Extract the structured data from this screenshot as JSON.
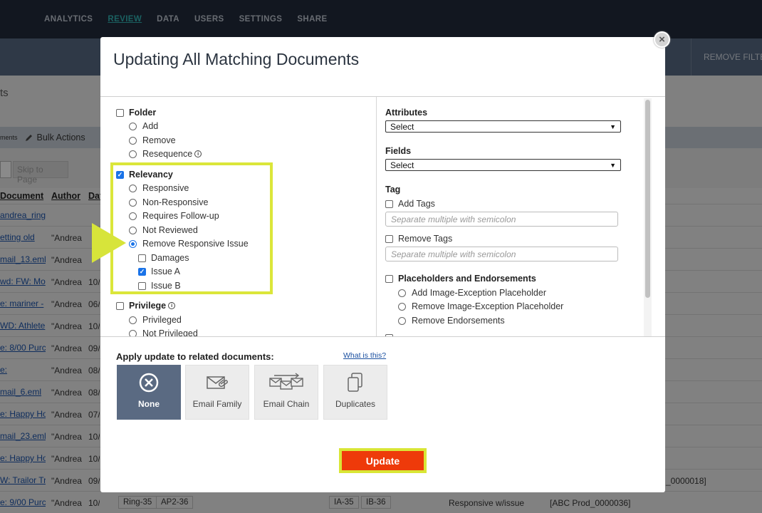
{
  "nav": {
    "items": [
      "ANALYTICS",
      "REVIEW",
      "DATA",
      "USERS",
      "SETTINGS",
      "SHARE"
    ],
    "active": "REVIEW"
  },
  "toolbar": {
    "remove_filters": "REMOVE FILTE"
  },
  "page": {
    "subtitle": "ts"
  },
  "actions": {
    "fragment": "ments",
    "bulk_actions": "Bulk Actions"
  },
  "pager": {
    "skip_placeholder": "Skip to Page"
  },
  "grid": {
    "headers": [
      "Document",
      "Author",
      "Dat"
    ],
    "rows": [
      {
        "doc": "andrea_ring_l",
        "author": "",
        "date": ""
      },
      {
        "doc": "etting old",
        "author": "\"Andrea",
        "date": ""
      },
      {
        "doc": "mail_13.eml",
        "author": "\"Andrea",
        "date": ""
      },
      {
        "doc": "wd: FW: Mo",
        "author": "\"Andrea",
        "date": "10/"
      },
      {
        "doc": "e: mariner -",
        "author": "\"Andrea",
        "date": "06/"
      },
      {
        "doc": "WD: Athlete",
        "author": "\"Andrea",
        "date": "10/"
      },
      {
        "doc": "e: 8/00 Purc",
        "author": "\"Andrea",
        "date": "09/"
      },
      {
        "doc": "e:",
        "author": "\"Andrea",
        "date": "08/"
      },
      {
        "doc": "mail_6.eml",
        "author": "\"Andrea",
        "date": "08/"
      },
      {
        "doc": "e: Happy Ho",
        "author": "\"Andrea",
        "date": "07/"
      },
      {
        "doc": "mail_23.eml",
        "author": "\"Andrea",
        "date": "10/"
      },
      {
        "doc": "e: Happy Ho",
        "author": "\"Andrea",
        "date": "10/"
      },
      {
        "doc": "W: Trailor Tr",
        "author": "\"Andrea",
        "date": "09/"
      },
      {
        "doc": "e: 9/00 Purc",
        "author": "\"Andrea",
        "date": "10/1("
      }
    ],
    "last_row_chips": [
      "Ring-35",
      "AP2-36",
      "IA-35",
      "IB-36"
    ],
    "last_row_relevancy": "Responsive w/issue",
    "last_row_bates": "[ABC Prod_0000036]",
    "prev_row_bates": "_0000018]"
  },
  "modal": {
    "title": "Updating All Matching Documents",
    "close_symbol": "×",
    "left": {
      "folder": {
        "label": "Folder",
        "options": [
          "Add",
          "Remove",
          "Resequence"
        ]
      },
      "relevancy": {
        "label": "Relevancy",
        "options": [
          "Responsive",
          "Non-Responsive",
          "Requires Follow-up",
          "Not Reviewed",
          "Remove Responsive Issue"
        ],
        "selected": "Remove Responsive Issue",
        "issues": [
          {
            "label": "Damages",
            "checked": false
          },
          {
            "label": "Issue A",
            "checked": true
          },
          {
            "label": "Issue B",
            "checked": false
          }
        ]
      },
      "privilege": {
        "label": "Privilege",
        "options": [
          "Privileged",
          "Not Privileged"
        ]
      }
    },
    "right": {
      "attributes": {
        "label": "Attributes",
        "value": "Select"
      },
      "fields": {
        "label": "Fields",
        "value": "Select"
      },
      "tag": {
        "label": "Tag",
        "add_label": "Add Tags",
        "add_placeholder": "Separate multiple with semicolon",
        "remove_label": "Remove Tags",
        "remove_placeholder": "Separate multiple with semicolon"
      },
      "placeholders": {
        "label": "Placeholders and Endorsements",
        "options": [
          "Add Image-Exception Placeholder",
          "Remove Image-Exception Placeholder",
          "Remove Endorsements"
        ]
      }
    },
    "apply": {
      "label": "Apply update to related documents:",
      "link": "What is this?",
      "options": [
        "None",
        "Email Family",
        "Email Chain",
        "Duplicates"
      ],
      "selected": "None"
    },
    "update_label": "Update"
  },
  "colors": {
    "nav_bg": "#1f2838",
    "accent": "#2fa8a8",
    "highlight": "#dbe63a",
    "update_button": "#ee3a0a",
    "selected_option": "#5a6a82",
    "checkbox": "#1a73e8"
  }
}
